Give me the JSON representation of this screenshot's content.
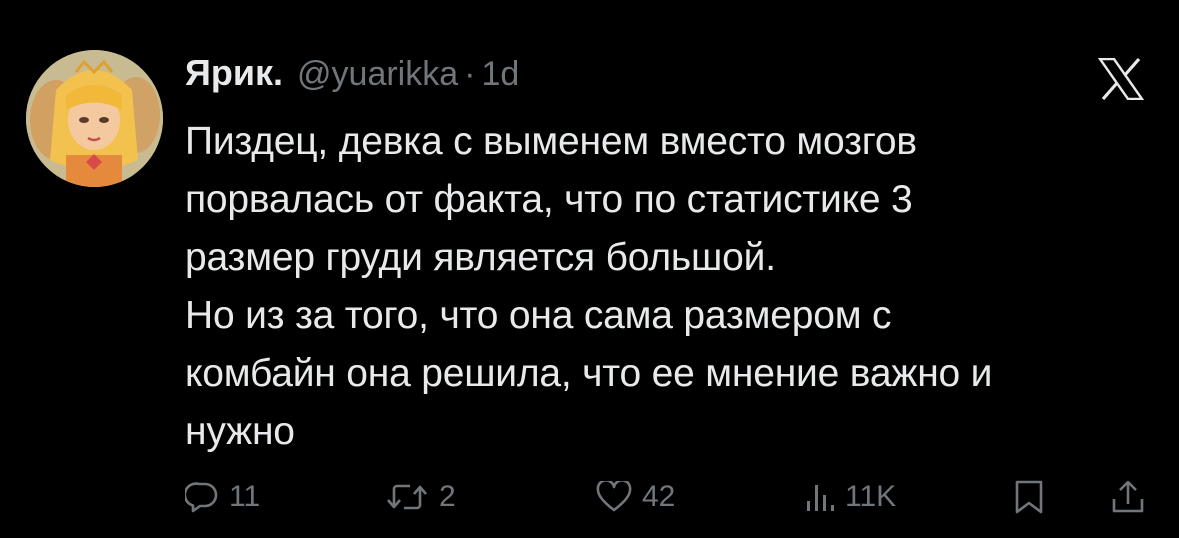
{
  "tweet": {
    "display_name": "Ярик.",
    "handle": "@yuarikka",
    "separator": "·",
    "time": "1d",
    "text": "Пиздец, девка с выменем вместо мозгов\nпорвалась от факта, что по статистике 3\nразмер груди является большой.\nНо из за того, что она сама размером с\nкомбайн она решила, что ее мнение важно и\nнужно"
  },
  "actions": {
    "replies": "11",
    "retweets": "2",
    "likes": "42",
    "views": "11K"
  },
  "icons": {
    "brand": "x-logo-icon",
    "reply": "reply-icon",
    "retweet": "retweet-icon",
    "like": "heart-icon",
    "views": "views-icon",
    "bookmark": "bookmark-icon",
    "share": "share-icon"
  },
  "colors": {
    "background": "#000000",
    "text": "#e7e9ea",
    "secondary": "#71767b"
  }
}
